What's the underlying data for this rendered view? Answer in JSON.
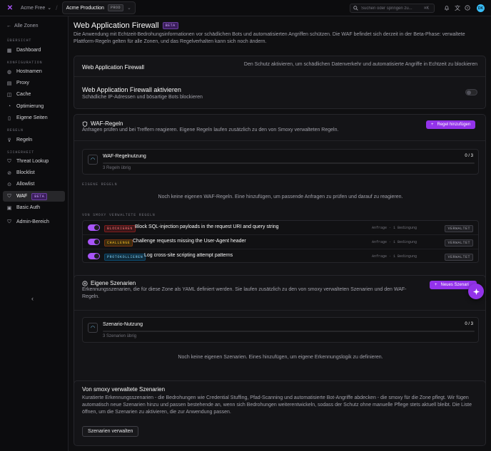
{
  "topbar": {
    "team": "Acme Free",
    "project": "Acme Production",
    "env_badge": "PROD",
    "search_placeholder": "Suchen oder springen zu...",
    "search_shortcut": "⌘K",
    "avatar_initials": "DK"
  },
  "sidebar": {
    "back": "Alle Zonen",
    "sections": {
      "overview": "ÜBERSICHT",
      "config": "KONFIGURATION",
      "rules": "REGELN",
      "security": "SICHERHEIT"
    },
    "items": {
      "dashboard": "Dashboard",
      "hostnames": "Hostnamen",
      "proxy": "Proxy",
      "cache": "Cache",
      "optimierung": "Optimierung",
      "eigene_seiten": "Eigene Seiten",
      "regeln": "Regeln",
      "threat_lookup": "Threat Lookup",
      "blocklist": "Blocklist",
      "allowlist": "Allowlist",
      "waf": "WAF",
      "waf_badge": "BETA",
      "basic_auth": "Basic Auth",
      "admin": "Admin-Bereich"
    }
  },
  "page": {
    "title": "Web Application Firewall",
    "title_badge": "BETA",
    "intro": "Die Anwendung mit Echtzeit-Bedrohungsinformationen vor schädlichen Bots und automatisierten Angriffen schützen. Die WAF befindet sich derzeit in der Beta-Phase: verwaltete Plattform-Regeln gelten für alle Zonen, und das Regelverhalten kann sich noch ändern."
  },
  "waf_card": {
    "title": "Web Application Firewall",
    "hint": "Den Schutz aktivieren, um schädlichen Datenverkehr und automatisierte Angriffe in Echtzeit zu blockieren",
    "toggle_title": "Web Application Firewall aktivieren",
    "toggle_sub": "Schädliche IP-Adressen und bösartige Bots blockieren",
    "enabled": false
  },
  "rules_card": {
    "title": "WAF-Regeln",
    "sub": "Anfragen prüfen und bei Treffern reagieren. Eigene Regeln laufen zusätzlich zu den von Smoxy verwalteten Regeln.",
    "add_button": "Regel hinzufügen",
    "usage_title": "WAF-Regelnutzung",
    "usage_count": "0 / 3",
    "usage_sub": "3 Regeln übrig",
    "usage_fraction": 0,
    "own_label": "EIGENE REGELN",
    "own_empty": "Noch keine eigenen WAF-Regeln. Eine hinzufügen, um passende Anfragen zu prüfen und darauf zu reagieren.",
    "managed_label": "VON SMOXY VERWALTETE REGELN",
    "managed": [
      {
        "action": "BLOCKIEREN",
        "name": "Block SQL-injection payloads in the request URI and query string",
        "meta": "Anfrage · 1 Bedingung",
        "badge": "VERWALTET"
      },
      {
        "action": "CHALLENGE",
        "name": "Challenge requests missing the User-Agent header",
        "meta": "Anfrage · 1 Bedingung",
        "badge": "VERWALTET"
      },
      {
        "action": "PROTOKOLLIEREN",
        "name": "Log cross-site scripting attempt patterns",
        "meta": "Anfrage · 1 Bedingung",
        "badge": "VERWALTET"
      }
    ]
  },
  "scenarios_card": {
    "title": "Eigene Szenarien",
    "sub": "Erkennungsszenarien, die für diese Zone als YAML definiert werden. Sie laufen zusätzlich zu den von smoxy verwalteten Szenarien und den WAF-Regeln.",
    "add_button": "Neues Szenari",
    "usage_title": "Szenario-Nutzung",
    "usage_count": "0 / 3",
    "usage_sub": "3 Szenarien übrig",
    "usage_fraction": 0,
    "empty": "Noch keine eigenen Szenarien. Eines hinzufügen, um eigene Erkennungslogik zu definieren."
  },
  "managed_card": {
    "title": "Von smoxy verwaltete Szenarien",
    "text": "Kuratierte Erkennungsszenarien - die Bedrohungen wie Credential Stuffing, Pfad-Scanning und automatisierte Bot-Angriffe abdecken - die smoxy für die Zone pflegt. Wir fügen automatisch neue Szenarien hinzu und passen bestehende an, wenn sich Bedrohungen weiterentwickeln, sodass der Schutz ohne manuelle Pflege stets aktuell bleibt. Die Liste öffnen, um die Szenarien zu aktivieren, die zur Anwendung passen.",
    "button": "Szenarien verwalten"
  },
  "colors": {
    "accent": "#9333ea",
    "background": "#0f0f11",
    "card": "#141417"
  },
  "icons": [
    "logo-icon",
    "search-icon",
    "bell-icon",
    "translate-icon",
    "help-icon",
    "shield-icon",
    "scenario-icon",
    "plus-icon",
    "gauge-icon",
    "sparkle-icon",
    "chevron-left-icon"
  ]
}
